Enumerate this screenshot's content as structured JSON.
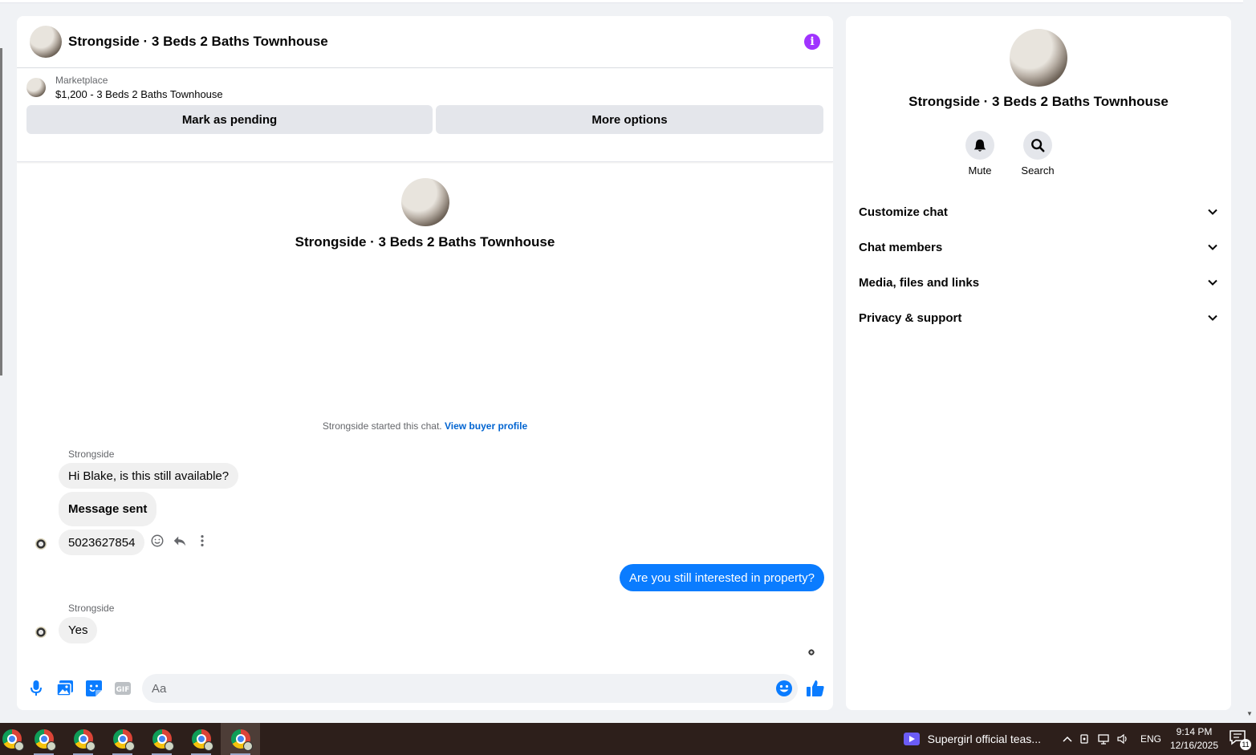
{
  "header": {
    "title": "Strongside · 3 Beds 2 Baths Townhouse",
    "info_icon": "info-icon"
  },
  "marketplace": {
    "label": "Marketplace",
    "listing": "$1,200 - 3 Beds 2 Baths Townhouse",
    "mark_pending_label": "Mark as pending",
    "more_options_label": "More options"
  },
  "intro": {
    "title": "Strongside · 3 Beds 2 Baths Townhouse"
  },
  "thread": {
    "started_text": "Strongside started this chat.",
    "view_profile_link": "View buyer profile",
    "group1_sender": "Strongside",
    "msg1": "Hi Blake, is this still available?",
    "msg2": "Message sent",
    "msg3": "5023627854",
    "my_msg": "Are you still interested in property?",
    "group2_sender": "Strongside",
    "msg4": "Yes"
  },
  "composer": {
    "placeholder": "Aa"
  },
  "side": {
    "title": "Strongside · 3 Beds 2 Baths Townhouse",
    "mute_label": "Mute",
    "search_label": "Search",
    "sections": [
      "Customize chat",
      "Chat members",
      "Media, files and links",
      "Privacy & support"
    ]
  },
  "taskbar": {
    "media_title": "Supergirl official teas...",
    "language": "ENG",
    "time": "9:14 PM",
    "date": "12/16/2025",
    "notification_count": "11"
  },
  "colors": {
    "accent": "#0a7cff",
    "info": "#a033ff",
    "link": "#0064d1"
  }
}
